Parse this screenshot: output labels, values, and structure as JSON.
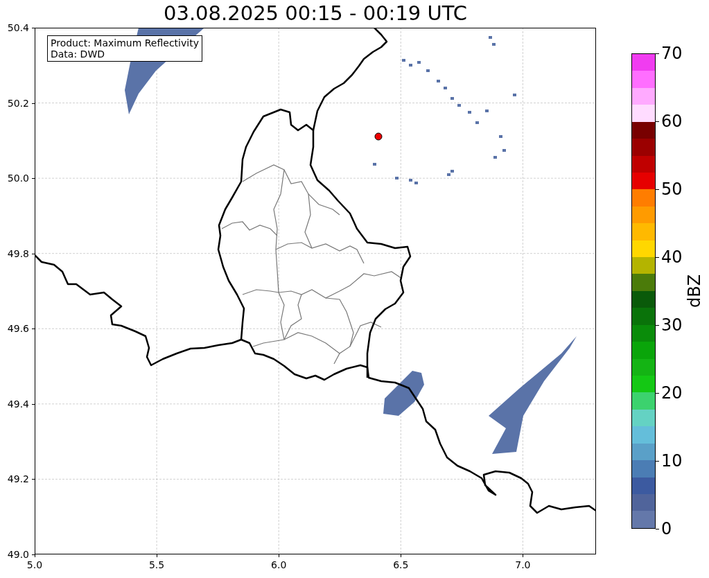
{
  "title": "03.08.2025 00:15 - 00:19 UTC",
  "info_box": {
    "lines": [
      "Product: Maximum Reflectivity",
      "Data: DWD"
    ]
  },
  "map": {
    "x_ticks": [
      "5.0",
      "5.5",
      "6.0",
      "6.5",
      "7.0"
    ],
    "y_ticks": [
      "50.4",
      "50.2",
      "50.0",
      "49.8",
      "49.6",
      "49.4",
      "49.2",
      "49.0"
    ]
  },
  "colorbar": {
    "label": "dBZ",
    "ticks": [
      "70",
      "60",
      "50",
      "40",
      "30",
      "20",
      "10",
      "0"
    ],
    "bands": [
      {
        "color": "#f03cf0"
      },
      {
        "color": "#ff6eff"
      },
      {
        "color": "#ffaaff"
      },
      {
        "color": "#ffdcff"
      },
      {
        "color": "#780000"
      },
      {
        "color": "#9b0000"
      },
      {
        "color": "#c00000"
      },
      {
        "color": "#e60000"
      },
      {
        "color": "#ff7d00"
      },
      {
        "color": "#ff9b00"
      },
      {
        "color": "#ffb900"
      },
      {
        "color": "#ffd700"
      },
      {
        "color": "#b4b400"
      },
      {
        "color": "#4b7b0a"
      },
      {
        "color": "#0a5a0a"
      },
      {
        "color": "#0a730a"
      },
      {
        "color": "#0a8c0a"
      },
      {
        "color": "#0aa50a"
      },
      {
        "color": "#14b414"
      },
      {
        "color": "#14c814"
      },
      {
        "color": "#3cd26e"
      },
      {
        "color": "#64d2c3"
      },
      {
        "color": "#64beda"
      },
      {
        "color": "#5aa0c8"
      },
      {
        "color": "#4b7db4"
      },
      {
        "color": "#3c5aa0"
      },
      {
        "color": "#50649b"
      },
      {
        "color": "#6478aa"
      }
    ]
  }
}
